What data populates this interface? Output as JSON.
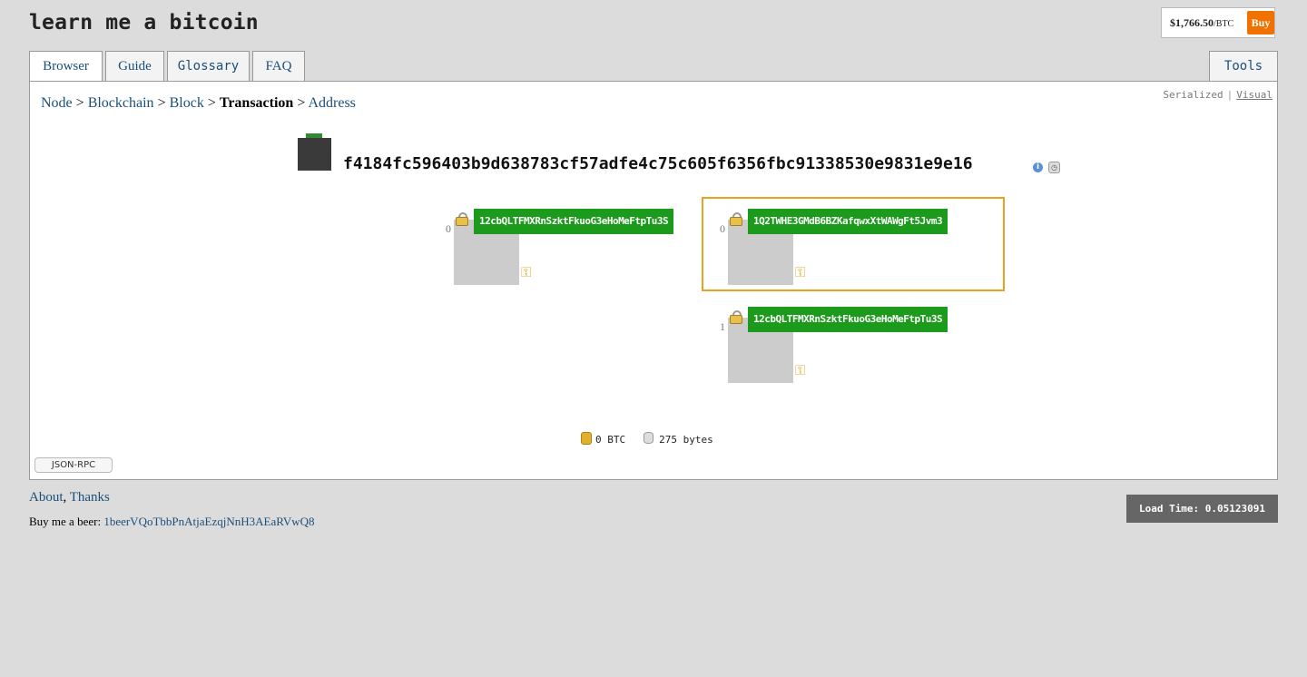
{
  "site": {
    "title": "learn me a bitcoin"
  },
  "price": {
    "value": "$1,766.50",
    "unit": "/BTC",
    "buy_label": "Buy"
  },
  "tabs": [
    {
      "label": "Browser"
    },
    {
      "label": "Guide"
    },
    {
      "label": "Glossary"
    },
    {
      "label": "FAQ"
    }
  ],
  "tools_tab": {
    "label": "Tools"
  },
  "breadcrumb": {
    "node": "Node",
    "blockchain": "Blockchain",
    "block": "Block",
    "transaction": "Transaction",
    "address": "Address",
    "separator": " > "
  },
  "view_toggle": {
    "serialized": "Serialized",
    "separator": "|",
    "visual": "Visual"
  },
  "transaction": {
    "hash": "f4184fc596403b9d638783cf57adfe4c75c605f6356fbc91338530e9831e9e16",
    "total_value": "0 BTC",
    "size": "275 bytes"
  },
  "inputs": [
    {
      "index": "0",
      "address": "12cbQLTFMXRnSzktFkuoG3eHoMeFtpTu3S"
    }
  ],
  "outputs": [
    {
      "index": "0",
      "address": "1Q2TWHE3GMdB6BZKafqwxXtWAWgFt5Jvm3"
    },
    {
      "index": "1",
      "address": "12cbQLTFMXRnSzktFkuoG3eHoMeFtpTu3S"
    }
  ],
  "rpc_button": {
    "label": "JSON-RPC"
  },
  "footer": {
    "about": "About",
    "comma": ",",
    "thanks": "Thanks",
    "beer_label": "Buy me a beer:",
    "beer_address": "1beerVQoTbbPnAtjaEzqjNnH3AEaRVwQ8",
    "load_time": "Load Time: 0.05123091"
  },
  "colors": {
    "address_green": "#1c9a1c",
    "highlight": "#f0a020",
    "buy_orange": "#f07000",
    "link_blue": "#1a4f7a"
  }
}
